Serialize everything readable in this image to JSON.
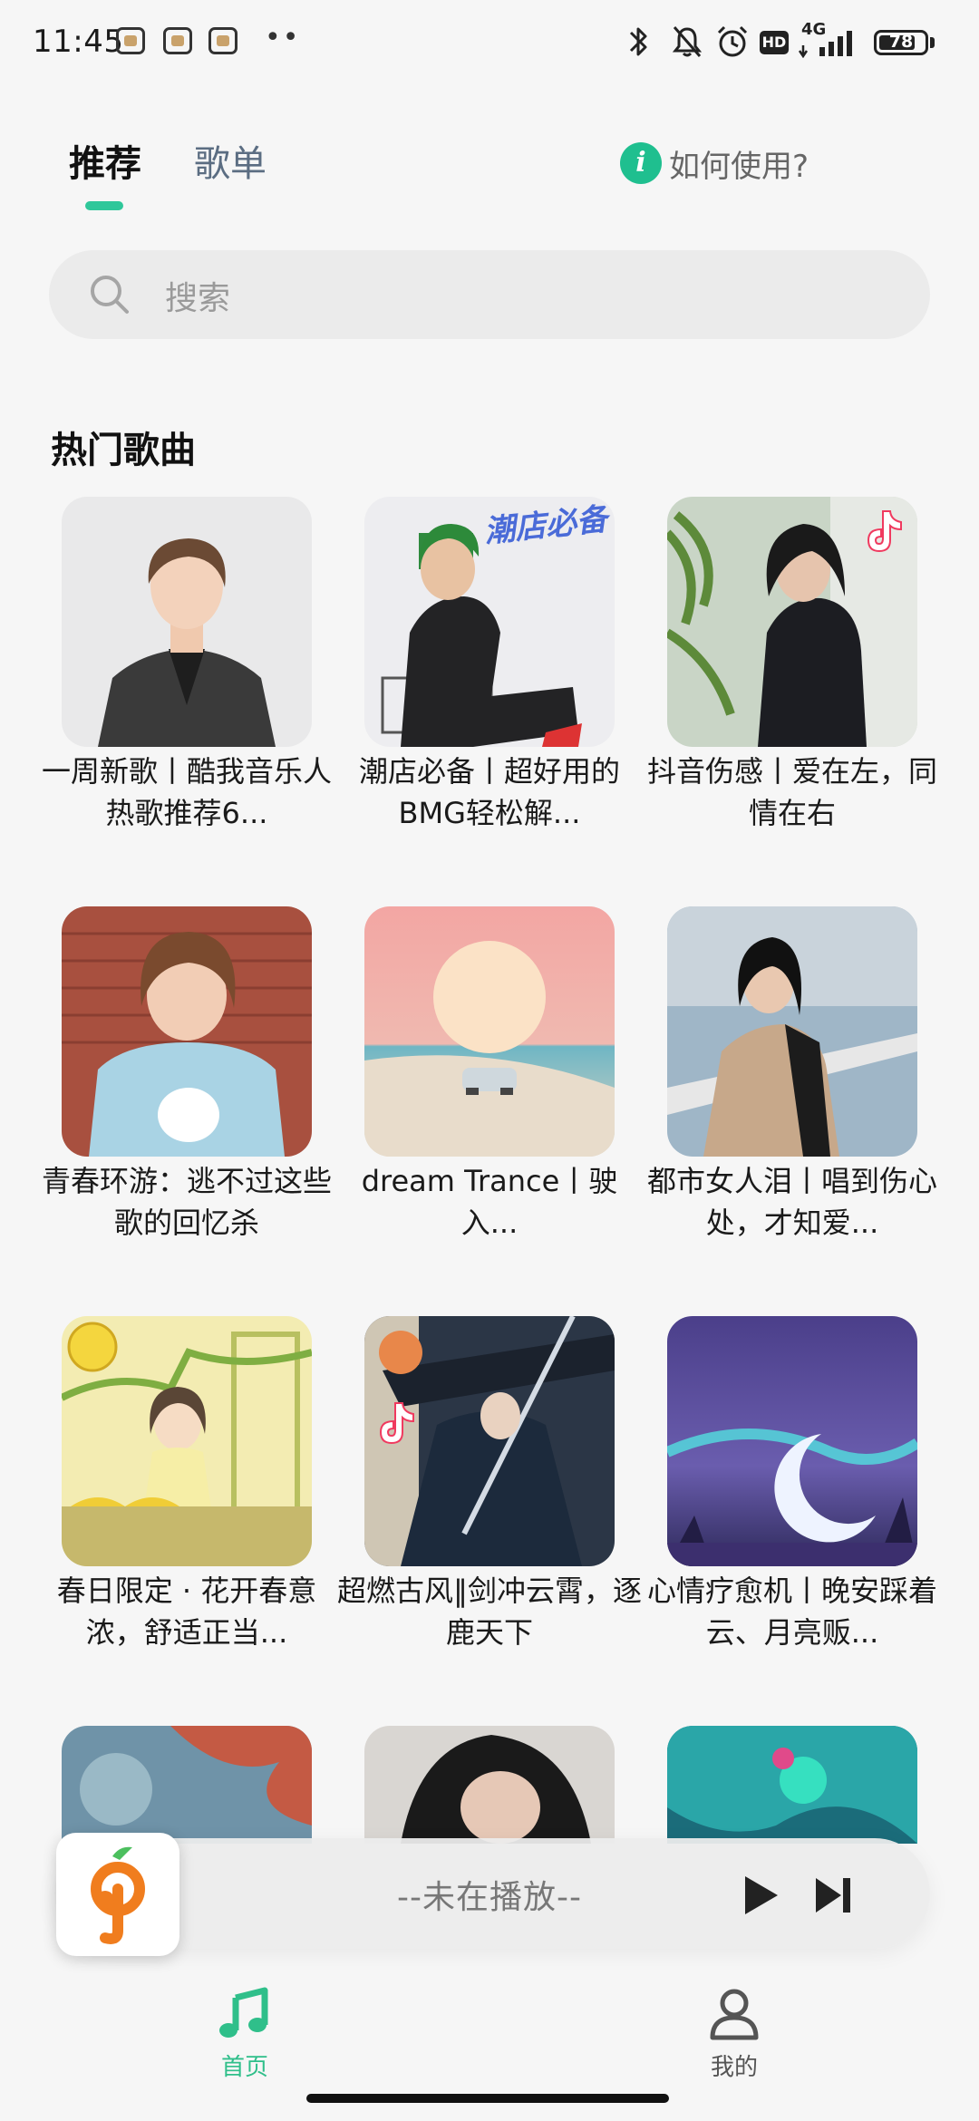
{
  "status_bar": {
    "time": "11:45",
    "network": "4G",
    "battery": "78",
    "icons": [
      "app-icon-1",
      "app-icon-2",
      "app-icon-3",
      "more-dots-icon",
      "bluetooth-icon",
      "mute-icon",
      "alarm-icon",
      "hd-icon",
      "signal-icon",
      "battery-icon"
    ],
    "hd": "HD"
  },
  "header": {
    "tabs": [
      {
        "label": "推荐",
        "active": true
      },
      {
        "label": "歌单",
        "active": false
      }
    ],
    "help_icon": "i",
    "help_label": "如何使用?",
    "accent": "#2fc79a"
  },
  "search": {
    "placeholder": "搜索"
  },
  "section": {
    "title": "热门歌曲",
    "cards": [
      {
        "title": "一周新歌丨酷我音乐人热歌推荐6..."
      },
      {
        "title": "潮店必备丨超好用的BMG轻松解..."
      },
      {
        "title": "抖音伤感丨爱在左，同情在右"
      },
      {
        "title": "青春环游：逃不过这些歌的回忆杀"
      },
      {
        "title": "dream Trance丨驶入..."
      },
      {
        "title": "都市女人泪丨唱到伤心处，才知爱..."
      },
      {
        "title": "春日限定 · 花开春意浓，舒适正当..."
      },
      {
        "title": "超燃古风‖剑冲云霄，逐鹿天下"
      },
      {
        "title": "心情疗愈机丨晚安踩着云、月亮贩..."
      }
    ],
    "cover_badge": "潮店必备"
  },
  "player": {
    "status": "--未在播放--",
    "play_icon": "play-icon",
    "next_icon": "next-track-icon"
  },
  "bottom_nav": {
    "items": [
      {
        "label": "首页",
        "icon": "music-note-icon",
        "active": true
      },
      {
        "label": "我的",
        "icon": "person-icon",
        "active": false
      }
    ]
  }
}
